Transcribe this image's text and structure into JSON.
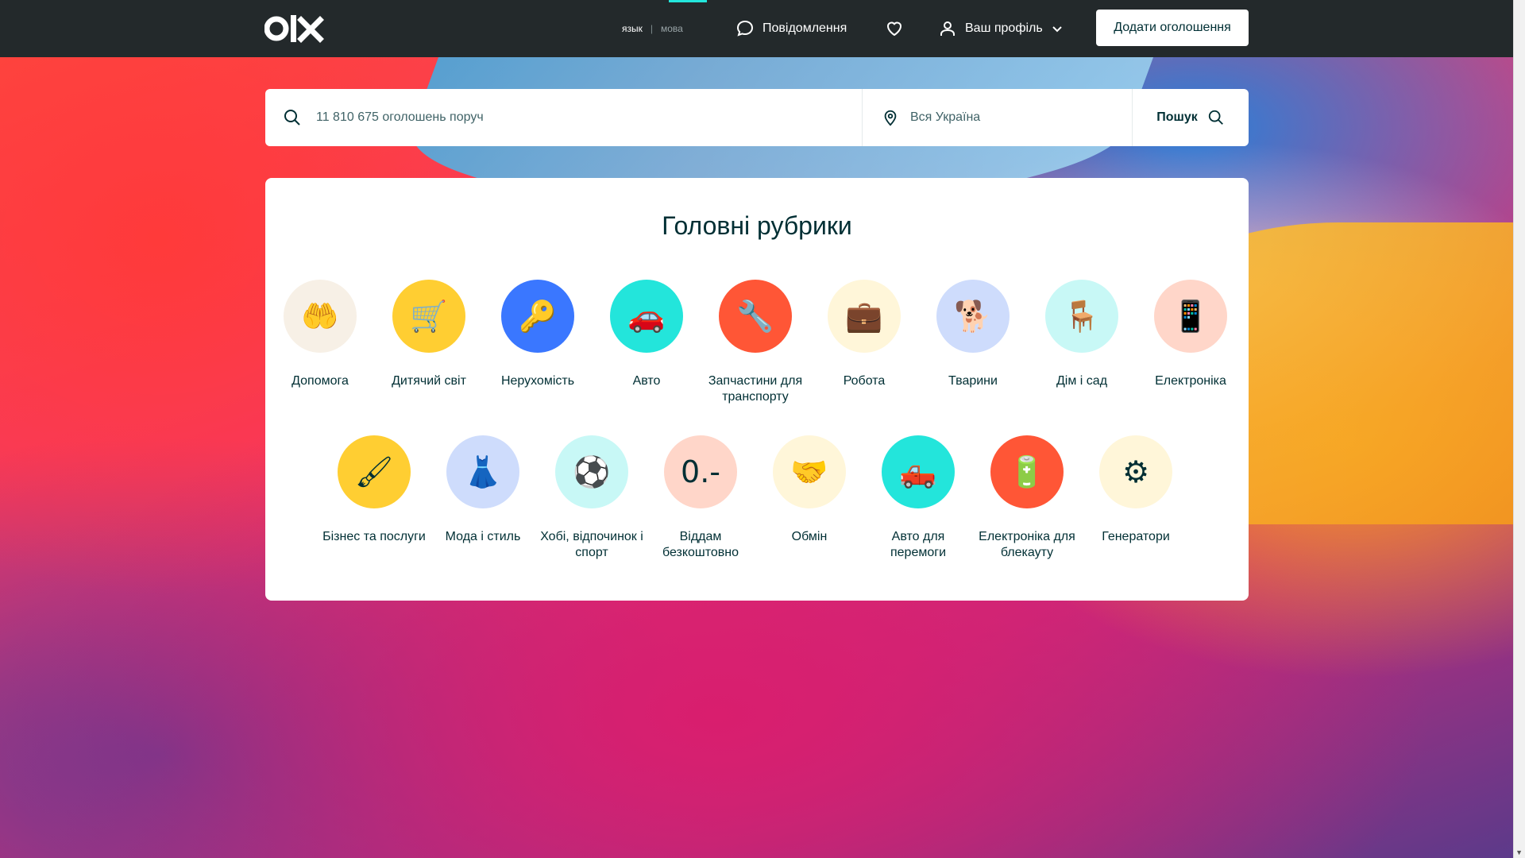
{
  "header": {
    "logo": "olx",
    "lang_ru": "язык",
    "lang_sep": "|",
    "lang_uk": "мова",
    "messages_label": "Повідомлення",
    "profile_label": "Ваш профіль",
    "add_button_label": "Додати оголошення",
    "icons": {
      "messages": "chat-bubble-icon",
      "favorites": "heart-icon",
      "profile": "user-icon",
      "profile_arrow": "chevron-down-icon"
    }
  },
  "search": {
    "placeholder": "11 810 675 оголошень поруч",
    "value": "",
    "location_label": "Вся Україна",
    "button_label": "Пошук"
  },
  "categories": {
    "title": "Головні рубрики",
    "row1": [
      {
        "label": "Допомога",
        "bg": "#f7f0e6",
        "icon": "helping-hands-icon"
      },
      {
        "label": "Дитячий світ",
        "bg": "#ffce32",
        "icon": "stroller-icon"
      },
      {
        "label": "Нерухомість",
        "bg": "#3a77ff",
        "icon": "key-icon"
      },
      {
        "label": "Авто",
        "bg": "#23e5db",
        "icon": "car-icon"
      },
      {
        "label": "Запчастини для транспорту",
        "bg": "#ff5636",
        "icon": "wrench-icon"
      },
      {
        "label": "Робота",
        "bg": "#fff6d9",
        "icon": "briefcase-icon"
      },
      {
        "label": "Тварини",
        "bg": "#cedcfc",
        "icon": "dog-icon"
      },
      {
        "label": "Дім і сад",
        "bg": "#c8f8f6",
        "icon": "armchair-icon"
      },
      {
        "label": "Електроніка",
        "bg": "#ffd6c9",
        "icon": "smartphone-icon"
      }
    ],
    "row2": [
      {
        "label": "Бізнес та послуги",
        "bg": "#ffce32",
        "icon": "paint-roller-icon"
      },
      {
        "label": "Мода і стиль",
        "bg": "#cedcfc",
        "icon": "dress-icon"
      },
      {
        "label": "Хобі, відпочинок і спорт",
        "bg": "#c8f8f6",
        "icon": "soccer-ball-icon"
      },
      {
        "label": "Віддам безкоштовно",
        "bg": "#ffd6c9",
        "icon": "zero-price-tag-icon"
      },
      {
        "label": "Обмін",
        "bg": "#fff6d9",
        "icon": "handshake-icon"
      },
      {
        "label": "Авто для перемоги",
        "bg": "#23e5db",
        "icon": "pickup-truck-icon"
      },
      {
        "label": "Електроніка для блекауту",
        "bg": "#ff5636",
        "icon": "power-station-icon"
      },
      {
        "label": "Генератори",
        "bg": "#fff6d9",
        "icon": "generator-icon"
      }
    ]
  }
}
